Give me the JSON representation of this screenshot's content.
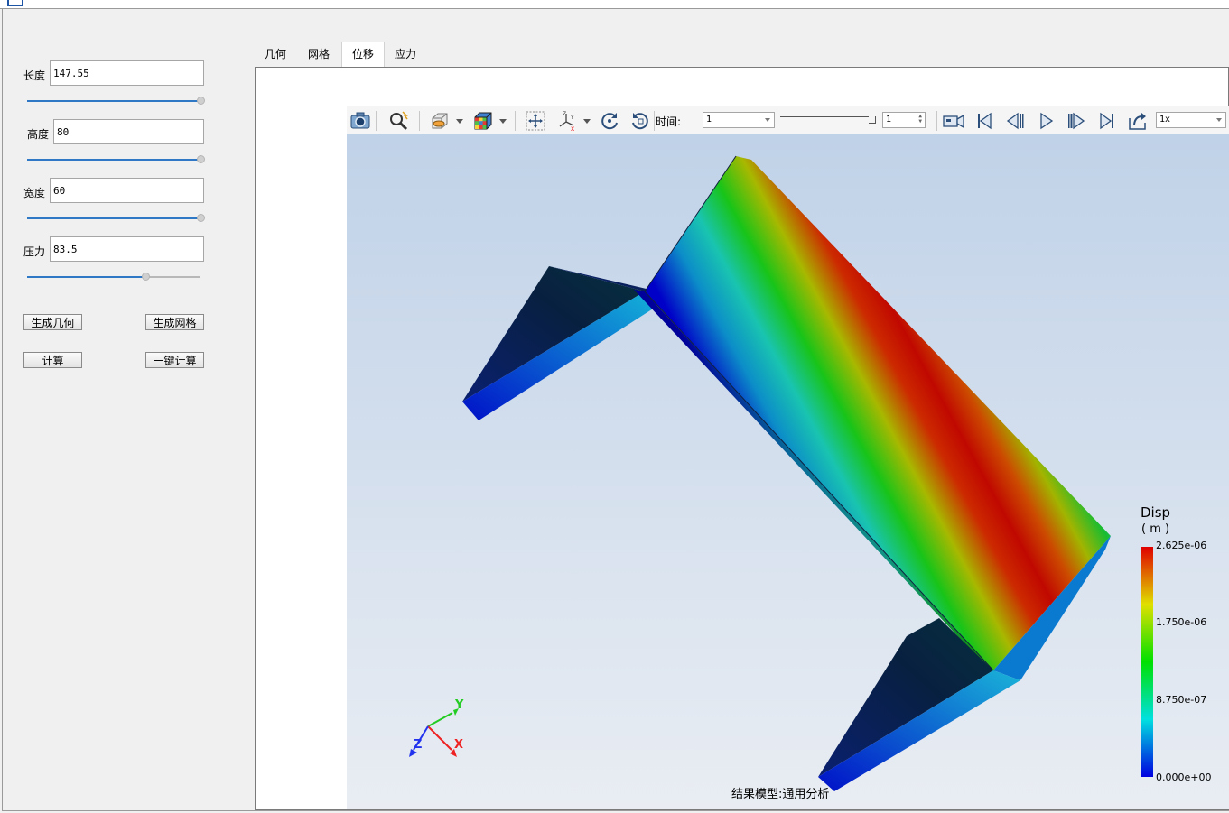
{
  "params": [
    {
      "label": "长度",
      "value": "147.55",
      "slider": 1.0
    },
    {
      "label": "高度",
      "value": "80",
      "slider": 1.0
    },
    {
      "label": "宽度",
      "value": "60",
      "slider": 1.0
    },
    {
      "label": "压力",
      "value": "83.5",
      "slider": 0.68
    }
  ],
  "buttons": {
    "gen_geometry": "生成几何",
    "gen_mesh": "生成网格",
    "compute": "计算",
    "one_click": "一键计算"
  },
  "tabs": [
    {
      "label": "几何",
      "active": false
    },
    {
      "label": "网格",
      "active": false
    },
    {
      "label": "位移",
      "active": true
    },
    {
      "label": "应力",
      "active": false
    }
  ],
  "toolbar": {
    "time_label": "时间:",
    "time_value": "1",
    "step_value": "1",
    "speed_value": "1x",
    "icons": [
      "camera-icon",
      "zoom-icon",
      "display-mode-icon",
      "colormap-icon",
      "fit-view-icon",
      "axes-icon",
      "rotate-icon",
      "reset-view-icon",
      "record-icon",
      "first-frame-icon",
      "prev-frame-icon",
      "play-icon",
      "next-frame-icon",
      "last-frame-icon",
      "export-icon"
    ]
  },
  "legend": {
    "title": "Disp",
    "unit": "( m )",
    "ticks": [
      "2.625e-06",
      "1.750e-06",
      "8.750e-07",
      "0.000e+00"
    ]
  },
  "axes": {
    "x": "X",
    "y": "Y",
    "z": "Z"
  },
  "model_label": "结果模型:通用分析",
  "colors": {
    "background_top": "#c0d2e8",
    "background_bottom": "#e9edf3",
    "scale_max": "#e00000",
    "scale_min": "#0000e0",
    "accent": "#2f78c6"
  }
}
